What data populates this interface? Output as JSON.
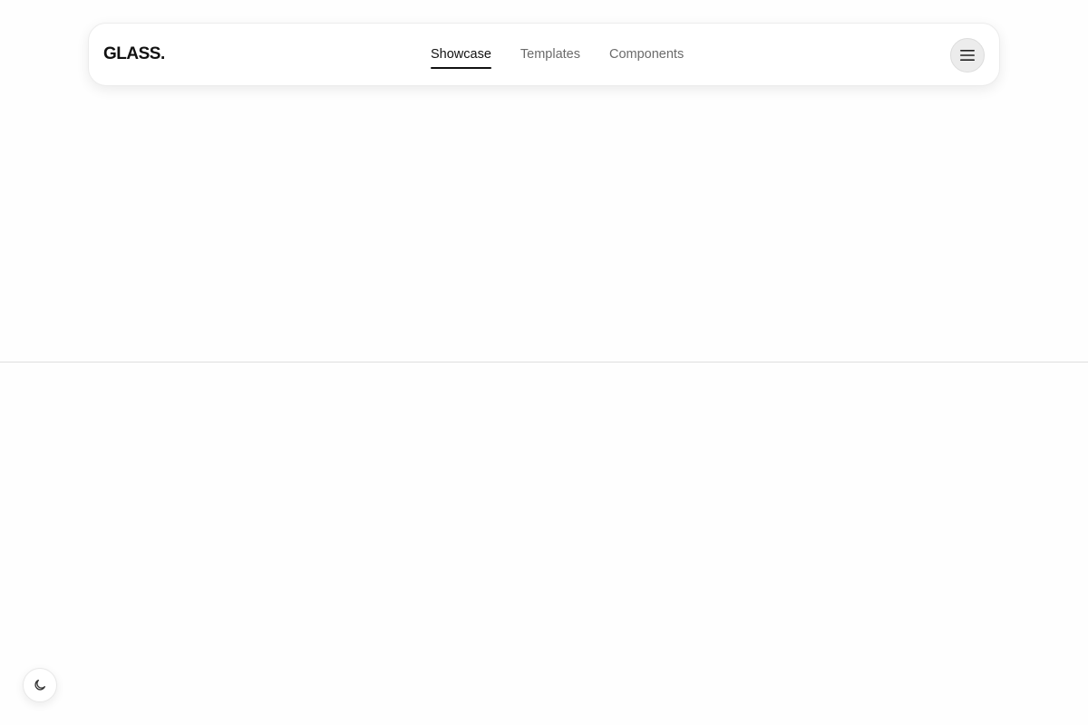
{
  "brand": {
    "logo_text": "GLASS."
  },
  "nav": {
    "tabs": [
      {
        "label": "Showcase",
        "active": true
      },
      {
        "label": "Templates",
        "active": false
      },
      {
        "label": "Components",
        "active": false
      }
    ]
  },
  "icons": {
    "menu": "hamburger-menu-icon",
    "theme": "moon-icon"
  },
  "colors": {
    "background": "#fefefe",
    "text_primary": "#111111",
    "text_muted": "#6b6b6b",
    "button_bg": "#ececec"
  }
}
